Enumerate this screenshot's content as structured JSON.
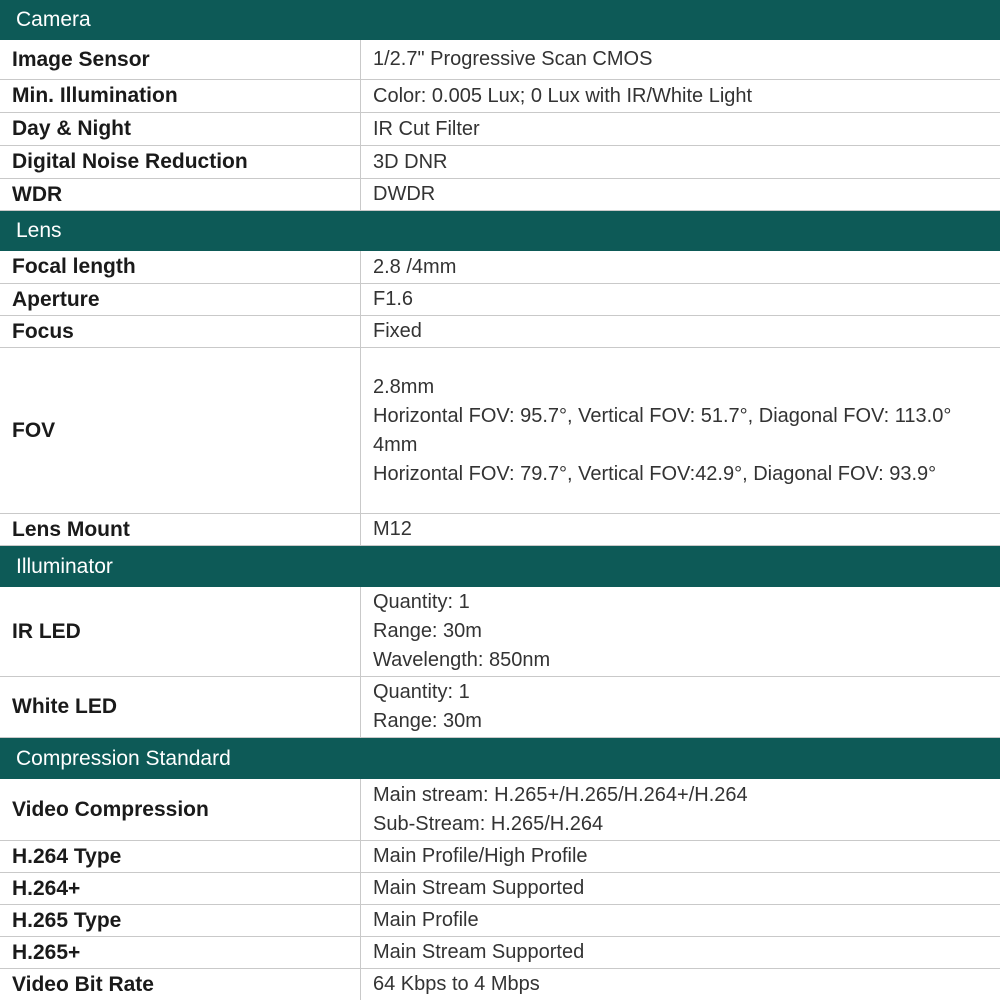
{
  "colors": {
    "header_bg": "#0d5a57",
    "header_text": "#ffffff",
    "border": "#c9c9c9"
  },
  "sections": [
    {
      "title": "Camera",
      "rows": [
        {
          "label": "Image Sensor",
          "values": [
            "1/2.7\" Progressive Scan CMOS"
          ]
        },
        {
          "label": "Min. Illumination",
          "values": [
            "Color: 0.005 Lux; 0 Lux with IR/White Light"
          ]
        },
        {
          "label": "Day & Night",
          "values": [
            "IR Cut Filter"
          ]
        },
        {
          "label": "Digital Noise Reduction",
          "values": [
            "3D DNR"
          ]
        },
        {
          "label": "WDR",
          "values": [
            "DWDR"
          ]
        }
      ]
    },
    {
      "title": "Lens",
      "rows": [
        {
          "label": "Focal length",
          "values": [
            "2.8 /4mm"
          ]
        },
        {
          "label": "Aperture",
          "values": [
            "F1.6"
          ]
        },
        {
          "label": "Focus",
          "values": [
            "Fixed"
          ]
        },
        {
          "label": "FOV",
          "values": [
            "2.8mm",
            "Horizontal FOV: 95.7°, Vertical FOV: 51.7°, Diagonal FOV: 113.0°",
            "4mm",
            "Horizontal FOV: 79.7°, Vertical FOV:42.9°, Diagonal FOV: 93.9°"
          ]
        },
        {
          "label": "Lens Mount",
          "values": [
            "M12"
          ]
        }
      ]
    },
    {
      "title": "Illuminator",
      "rows": [
        {
          "label": "IR LED",
          "values": [
            "Quantity: 1",
            "Range: 30m",
            "Wavelength: 850nm"
          ]
        },
        {
          "label": "White LED",
          "values": [
            "Quantity: 1",
            "Range: 30m"
          ]
        }
      ]
    },
    {
      "title": "Compression Standard",
      "rows": [
        {
          "label": "Video Compression",
          "values": [
            "Main stream: H.265+/H.265/H.264+/H.264",
            "Sub-Stream: H.265/H.264"
          ]
        },
        {
          "label": "H.264 Type",
          "values": [
            "Main Profile/High Profile"
          ]
        },
        {
          "label": "H.264+",
          "values": [
            "Main Stream Supported"
          ]
        },
        {
          "label": "H.265 Type",
          "values": [
            "Main Profile"
          ]
        },
        {
          "label": "H.265+",
          "values": [
            "Main Stream Supported"
          ]
        },
        {
          "label": "Video Bit Rate",
          "values": [
            "64 Kbps to 4 Mbps"
          ]
        }
      ]
    }
  ]
}
